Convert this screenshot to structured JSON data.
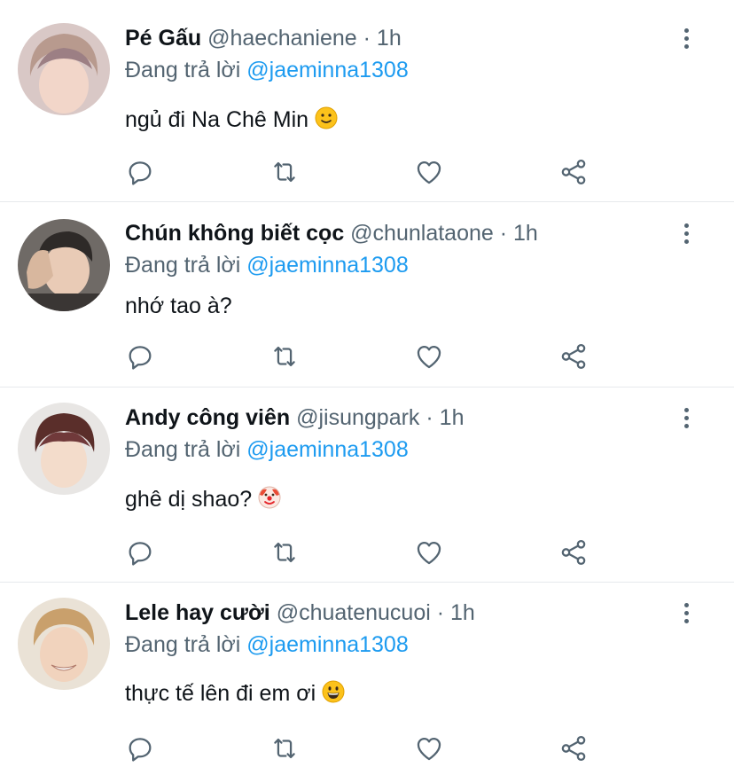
{
  "replying_prefix": "Đang trả lời",
  "tweets": [
    {
      "name": "Pé Gấu",
      "handle": "@haechaniene",
      "separator": "·",
      "time": "1h",
      "reply_to": "@jaeminna1308",
      "text": "ngủ đi Na Chê Min",
      "emoji": "slightly-smiling-face"
    },
    {
      "name": "Chún không biết cọc",
      "handle": "@chunlataone",
      "separator": "·",
      "time": "1h",
      "reply_to": "@jaeminna1308",
      "text": "nhớ tao à?",
      "emoji": ""
    },
    {
      "name": "Andy công viên",
      "handle": "@jisungpark",
      "separator": "·",
      "time": "1h",
      "reply_to": "@jaeminna1308",
      "text": "ghê dị shao?",
      "emoji": "clown-face"
    },
    {
      "name": "Lele hay cười",
      "handle": "@chuatenucuoi",
      "separator": "·",
      "time": "1h",
      "reply_to": "@jaeminna1308",
      "text": "thực tế lên đi em ơi",
      "emoji": "grinning-face"
    }
  ],
  "icons": {
    "reply": "reply-icon",
    "retweet": "retweet-icon",
    "like": "heart-icon",
    "share": "share-icon",
    "more": "more-vertical-icon"
  },
  "colors": {
    "text": "#0f1419",
    "muted": "#536471",
    "accent": "#1d9bf0",
    "divider": "#e6e9ec"
  }
}
